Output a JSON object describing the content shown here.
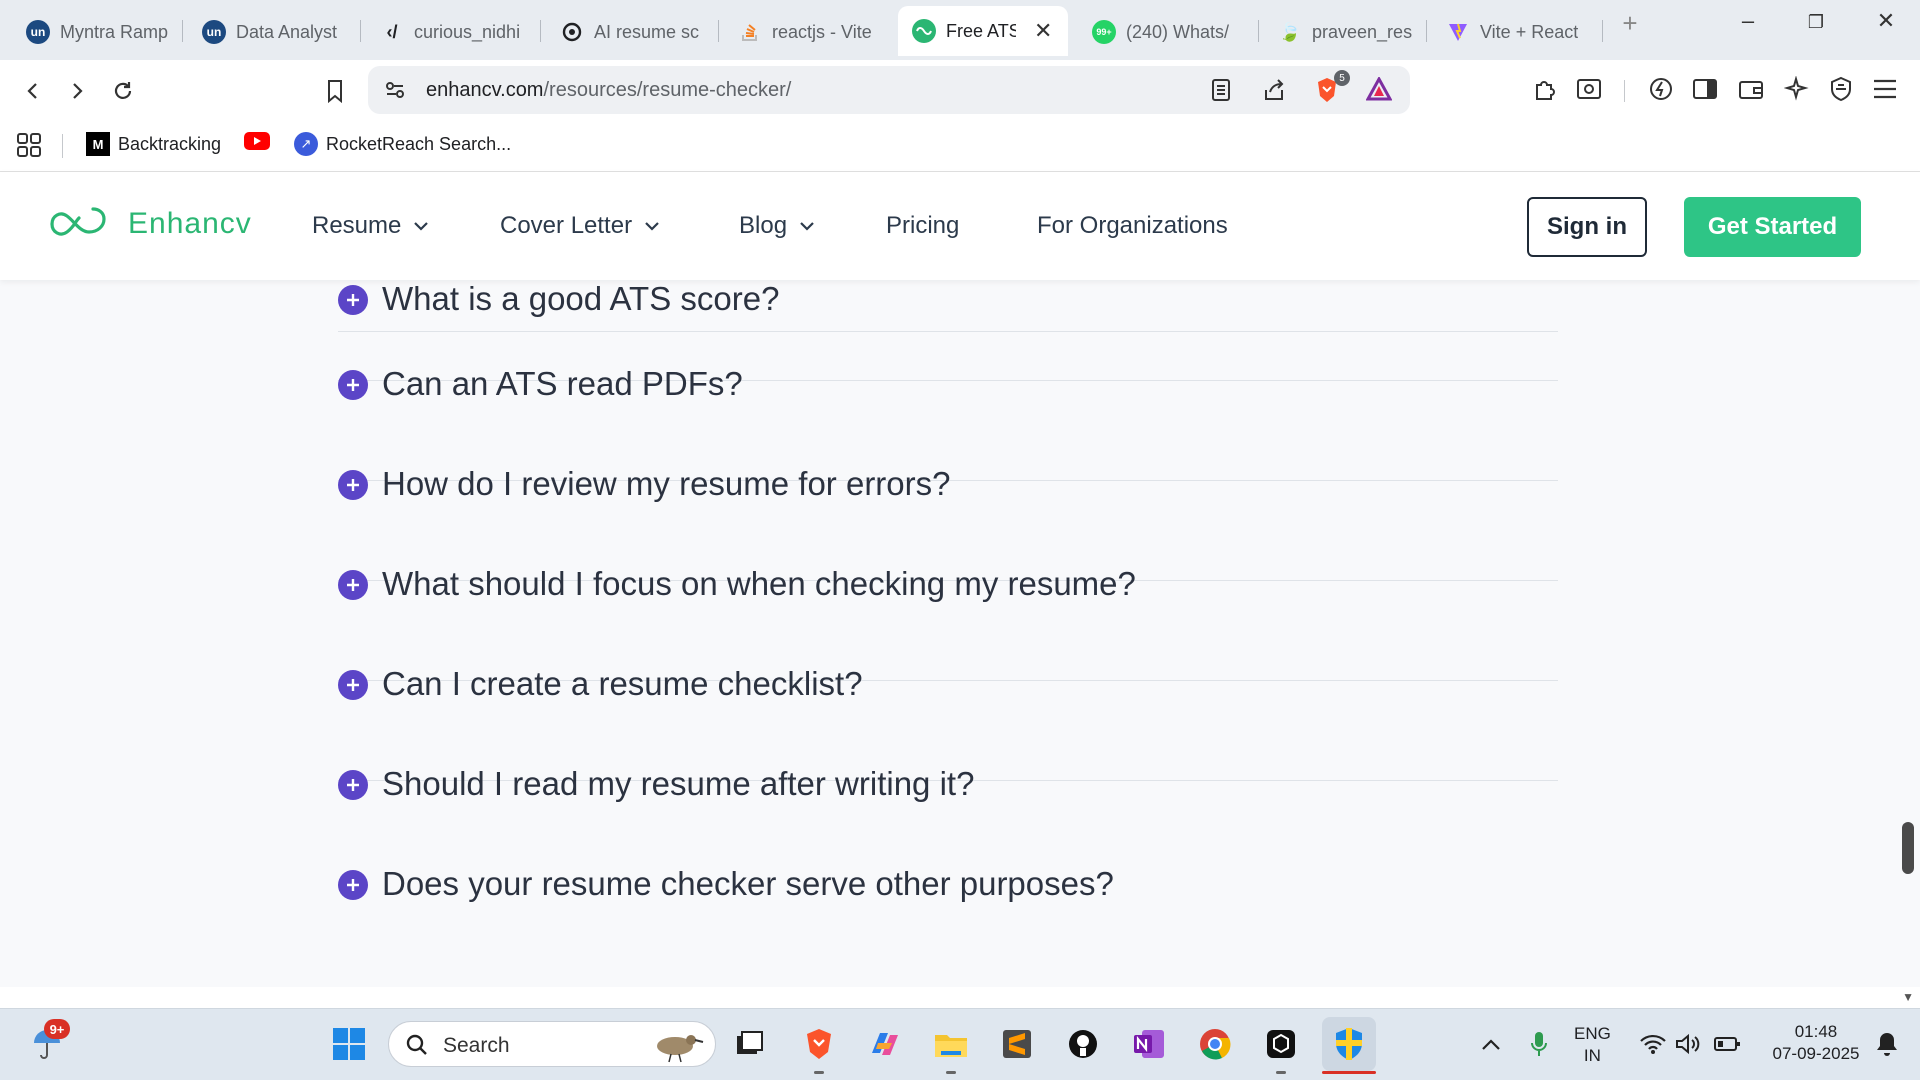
{
  "browser": {
    "tabs": [
      {
        "label": "Myntra Ramp",
        "icon": "unstop-icon",
        "color": "#1c4980"
      },
      {
        "label": "Data Analyst",
        "icon": "unstop-icon",
        "color": "#1c4980"
      },
      {
        "label": "curious_nidhi",
        "icon": "code-brackets-icon",
        "color": "#202124"
      },
      {
        "label": "AI resume sc",
        "icon": "openai-icon",
        "color": "#202124"
      },
      {
        "label": "reactjs - Vite",
        "icon": "stackoverflow-icon",
        "color": "#f48024"
      },
      {
        "label": "Free ATS",
        "icon": "enhancv-icon",
        "color": "#2bb673",
        "active": true
      },
      {
        "label": "(240) Whats/",
        "icon": "whatsapp-icon",
        "color": "#25d366",
        "badge": "99+"
      },
      {
        "label": "praveen_res",
        "icon": "leaf-icon",
        "color": "#202124"
      },
      {
        "label": "Vite + React",
        "icon": "vite-icon",
        "color": "#8f5cff"
      }
    ],
    "url_domain": "enhancv.com",
    "url_path": "/resources/resume-checker/",
    "brave_shield_count": "5",
    "bookmarks": [
      {
        "label": "Backtracking",
        "icon": "medium-icon"
      },
      {
        "label": "",
        "icon": "youtube-icon"
      },
      {
        "label": "RocketReach Search...",
        "icon": "rocketreach-icon"
      }
    ]
  },
  "site": {
    "logo_text": "Enhancv",
    "nav": [
      {
        "label": "Resume",
        "dropdown": true
      },
      {
        "label": "Cover Letter",
        "dropdown": true
      },
      {
        "label": "Blog",
        "dropdown": true
      },
      {
        "label": "Pricing",
        "dropdown": false
      },
      {
        "label": "For Organizations",
        "dropdown": false
      }
    ],
    "sign_in": "Sign in",
    "get_started": "Get Started",
    "brand_color": "#2ec586",
    "accent_color": "#5b45c7"
  },
  "faq": [
    "What is a good ATS score?",
    "Can an ATS read PDFs?",
    "How do I review my resume for errors?",
    "What should I focus on when checking my resume?",
    "Can I create a resume checklist?",
    "Should I read my resume after writing it?",
    "Does your resume checker serve other purposes?"
  ],
  "taskbar": {
    "weather_badge": "9+",
    "search_placeholder": "Search",
    "lang_top": "ENG",
    "lang_bottom": "IN",
    "time": "01:48",
    "date": "07-09-2025"
  }
}
